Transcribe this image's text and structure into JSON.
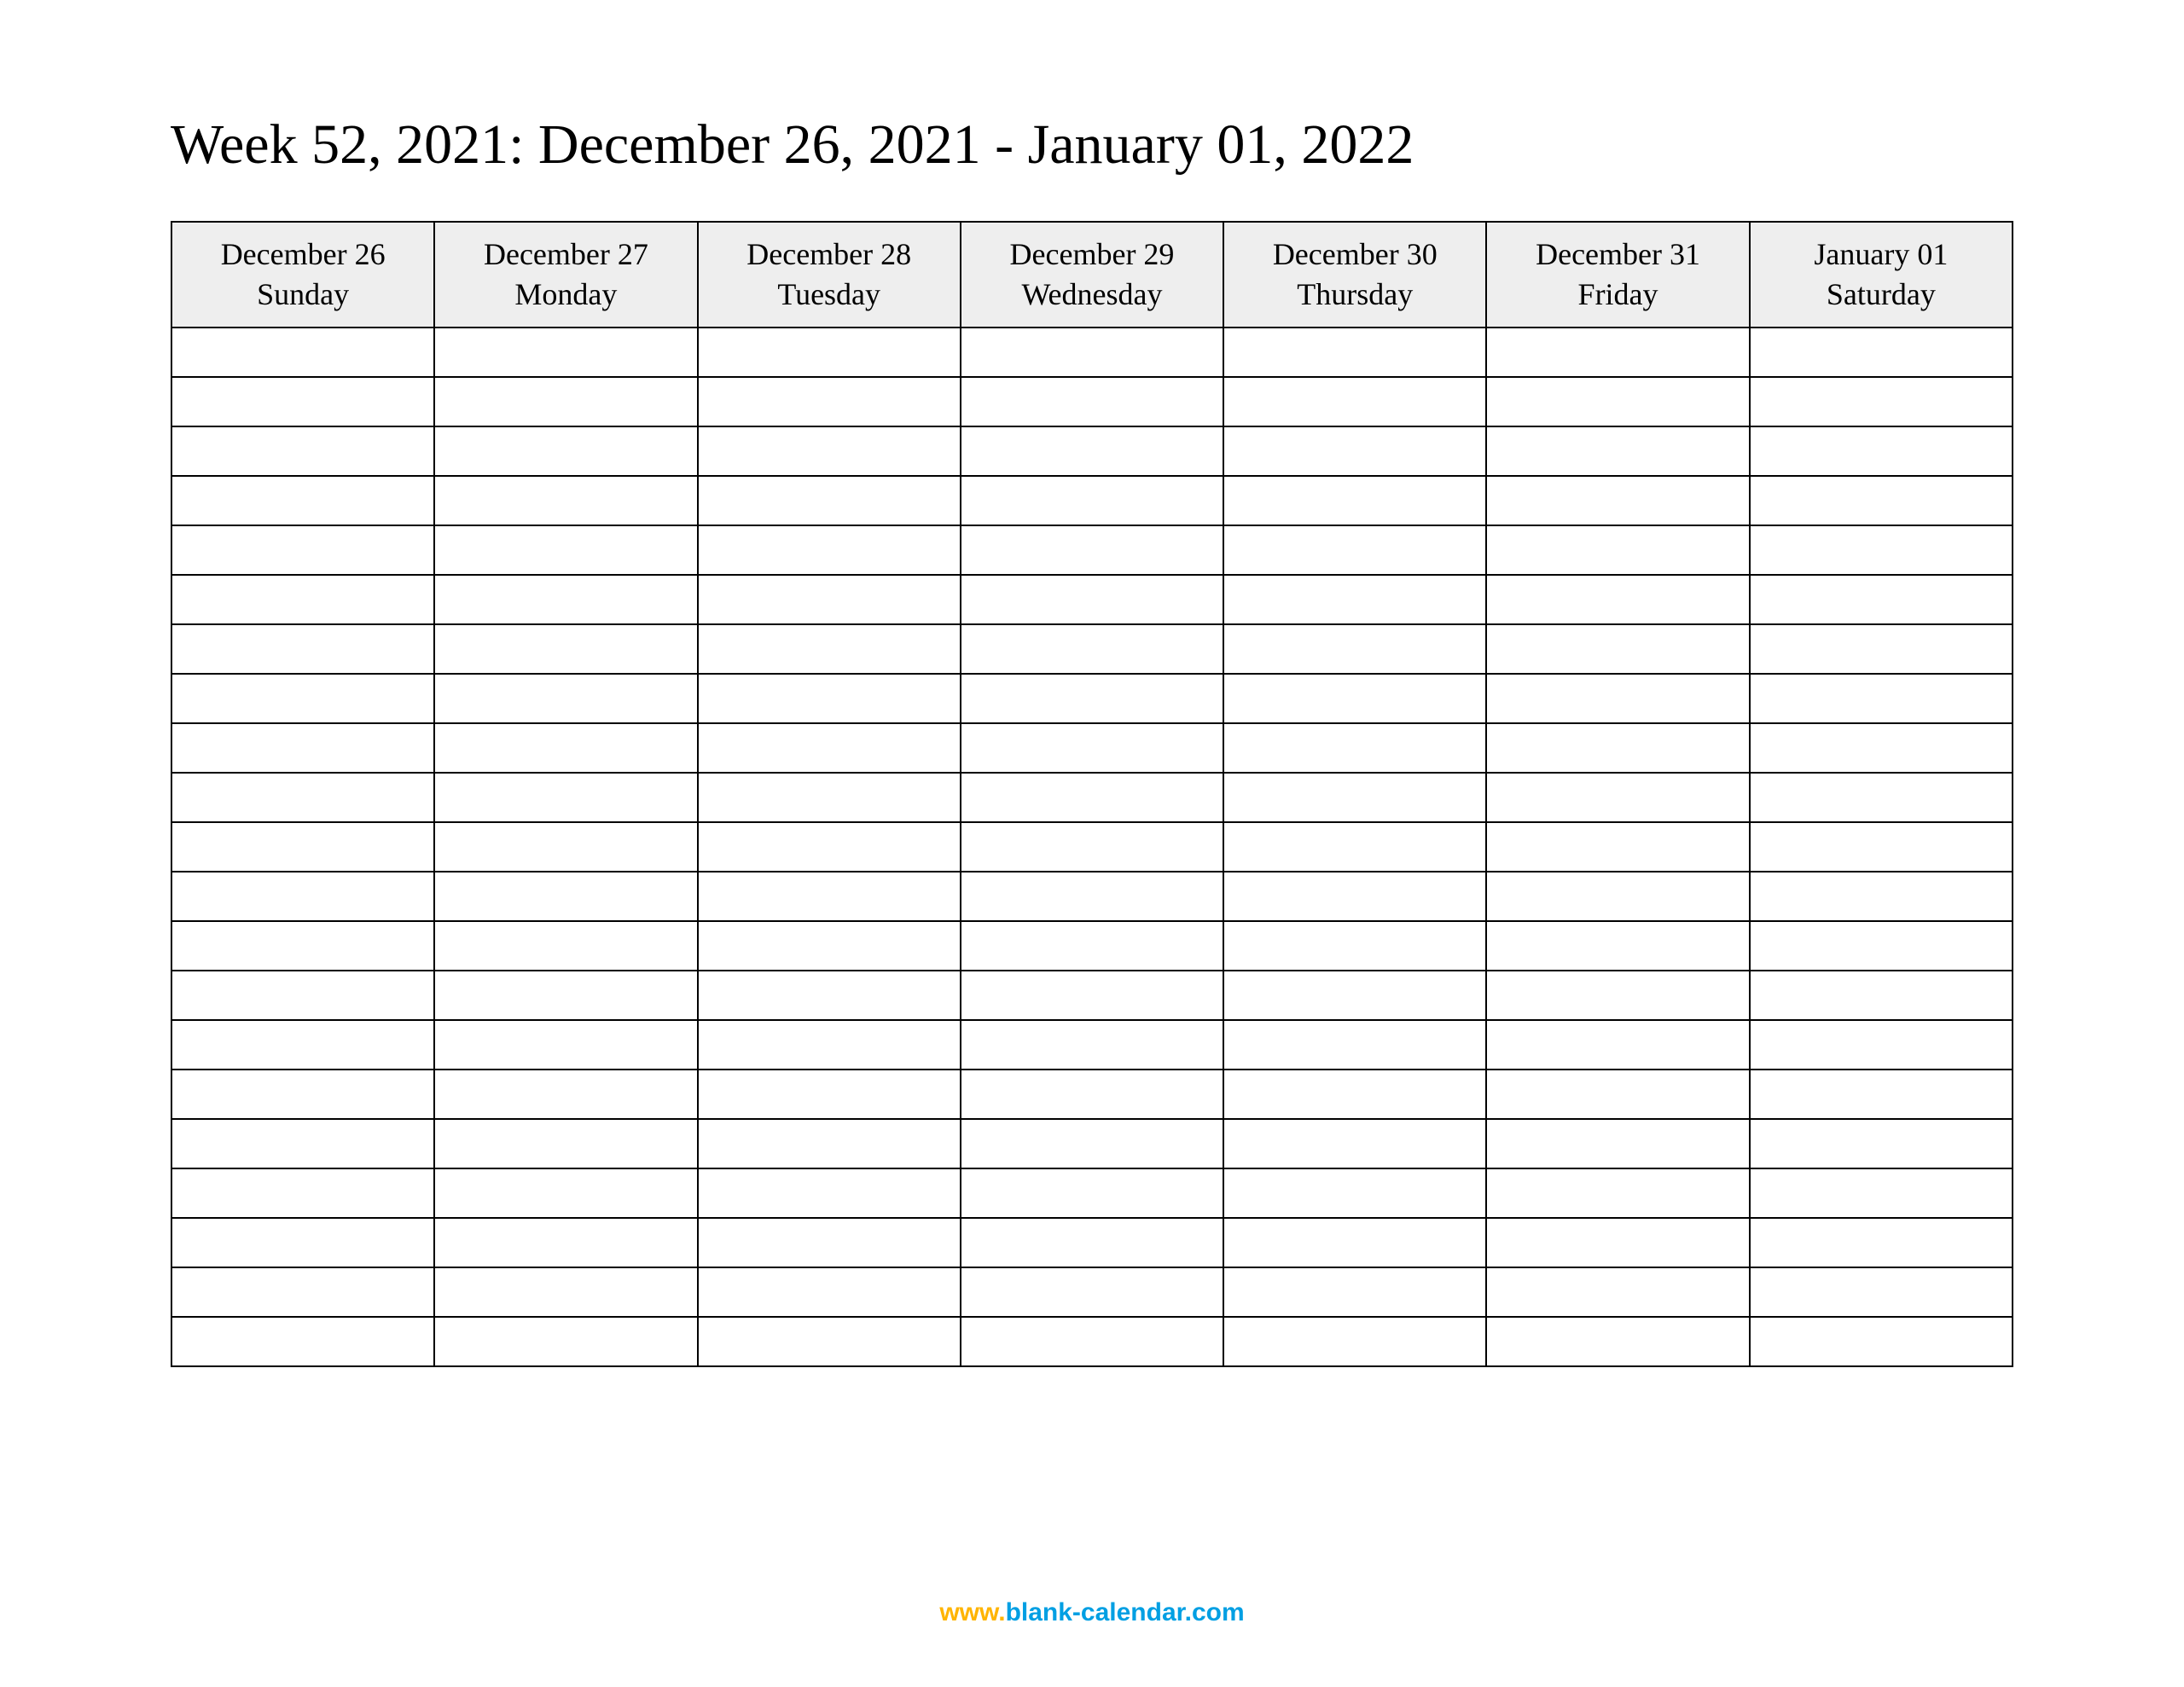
{
  "title": "Week 52, 2021: December 26, 2021 - January 01, 2022",
  "columns": [
    {
      "date": "December 26",
      "day": "Sunday"
    },
    {
      "date": "December 27",
      "day": "Monday"
    },
    {
      "date": "December 28",
      "day": "Tuesday"
    },
    {
      "date": "December 29",
      "day": "Wednesday"
    },
    {
      "date": "December 30",
      "day": "Thursday"
    },
    {
      "date": "December 31",
      "day": "Friday"
    },
    {
      "date": "January 01",
      "day": "Saturday"
    }
  ],
  "row_count": 21,
  "footer": {
    "www": "www.",
    "domain": "blank-calendar.com"
  }
}
